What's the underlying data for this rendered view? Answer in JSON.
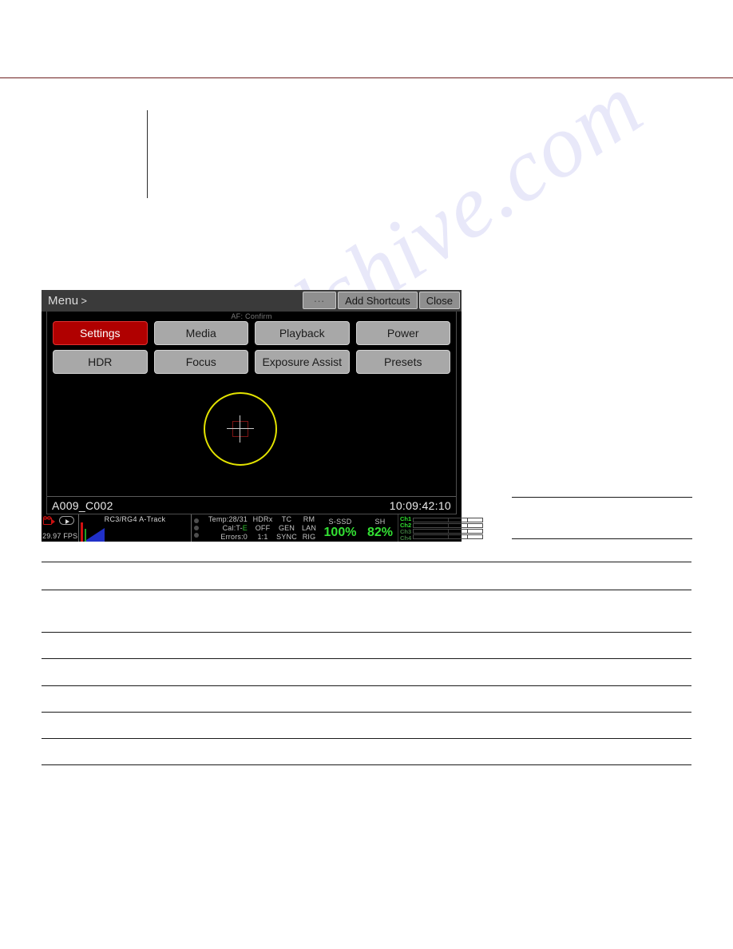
{
  "document": {
    "table_rule_tops": [
      703,
      738,
      791,
      824,
      858,
      891,
      924,
      957
    ],
    "right_rule_tops": [
      622,
      674
    ]
  },
  "watermark": {
    "text": "manualshive.com"
  },
  "camera": {
    "header": {
      "menu_label": "Menu",
      "menu_chevron": ">",
      "buttons": [
        {
          "name": "more-button",
          "label": "..."
        },
        {
          "name": "add-shortcuts-button",
          "label": "Add Shortcuts"
        },
        {
          "name": "close-button",
          "label": "Close"
        }
      ]
    },
    "af_confirm_label": "AF: Confirm",
    "shortcut_buttons": [
      {
        "label": "Settings",
        "active": true
      },
      {
        "label": "Media",
        "active": false
      },
      {
        "label": "Playback",
        "active": false
      },
      {
        "label": "Power",
        "active": false
      },
      {
        "label": "HDR",
        "active": false
      },
      {
        "label": "Focus",
        "active": false
      },
      {
        "label": "Exposure Assist",
        "active": false
      },
      {
        "label": "Presets",
        "active": false
      }
    ],
    "af_marker": {
      "circle_color": "#e3e300",
      "crosshair_box_color": "#7a1515",
      "crosshair_line_color": "#cccccc"
    },
    "strip": {
      "clip_name": "A009_C002",
      "timecode": "10:09:42:10"
    },
    "status": {
      "fps": "29.97 FPS",
      "track": "RC3/RG4  A-Track",
      "temp": "Temp:28/31",
      "cal_prefix": "Cal:T-",
      "cal_suffix": "E",
      "errors": "Errors:0",
      "hdr": "HDRx",
      "hdr_off": "OFF",
      "hdr_ratio": "1:1",
      "tc": "TC",
      "gen": "GEN",
      "sync": "SYNC",
      "rm": "RM",
      "lan": "LAN",
      "rig": "RIG",
      "ssd_label": "S-SSD",
      "ssd_value": "100%",
      "sh_label": "SH",
      "sh_value": "82%",
      "channels": [
        {
          "label": "Ch1",
          "active": true
        },
        {
          "label": "Ch2",
          "active": true
        },
        {
          "label": "Ch3",
          "active": false
        },
        {
          "label": "Ch4",
          "active": false
        }
      ]
    },
    "colors": {
      "accent_red": "#b00000",
      "status_green": "#33e033",
      "af_yellow": "#e3e300",
      "panel_gray": "#a8a8a8"
    }
  }
}
